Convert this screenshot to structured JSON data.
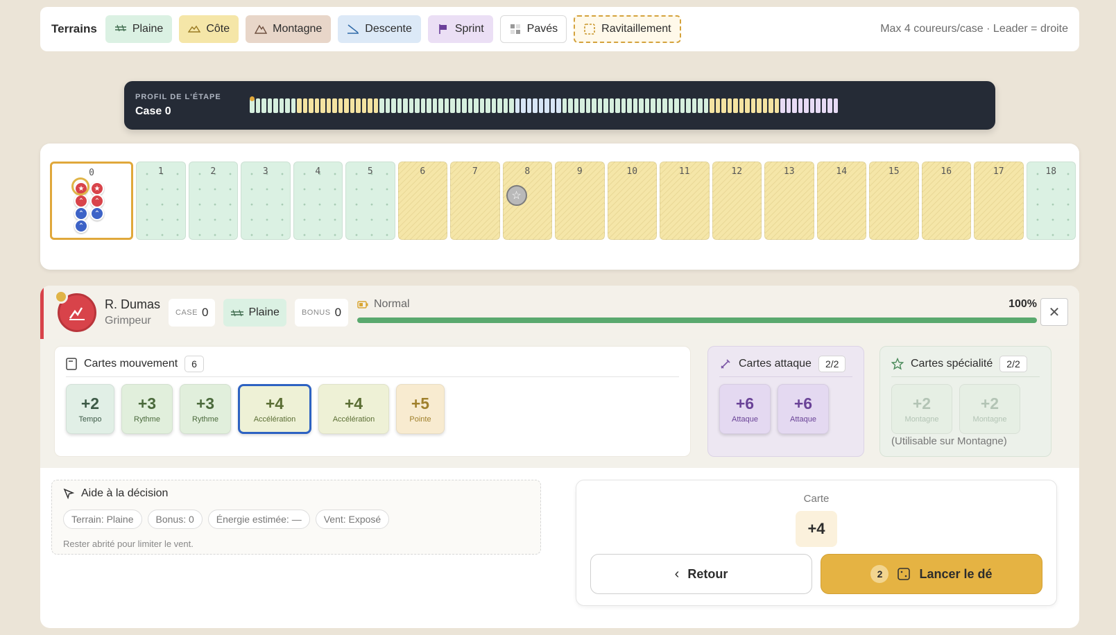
{
  "legend": {
    "title": "Terrains",
    "chips": [
      {
        "label": "Plaine",
        "bg": "#dbf1e3",
        "icon": "plaine-icon"
      },
      {
        "label": "Côte",
        "bg": "#f5e6a8",
        "icon": "cote-icon"
      },
      {
        "label": "Montagne",
        "bg": "#e8d6c9",
        "icon": "montagne-icon"
      },
      {
        "label": "Descente",
        "bg": "#dce9f7",
        "icon": "descente-icon"
      },
      {
        "label": "Sprint",
        "bg": "#ebdff5",
        "icon": "sprint-flag-icon"
      },
      {
        "label": "Pavés",
        "bg": "#ffffff",
        "icon": "paves-icon"
      },
      {
        "label": "Ravitaillement",
        "bg": "#fff9ea",
        "icon": "ravitaillement-icon"
      }
    ],
    "info": "Max 4 coureurs/case · Leader = droite"
  },
  "profile": {
    "label": "PROFIL DE L'ÉTAPE",
    "case": "Case 0",
    "segments": [
      "plaine",
      "plaine",
      "plaine",
      "plaine",
      "plaine",
      "plaine",
      "plaine",
      "plaine",
      "cote",
      "cote",
      "cote",
      "cote",
      "cote",
      "cote",
      "cote",
      "cote",
      "cote",
      "cote",
      "cote",
      "cote",
      "cote",
      "cote",
      "plaine",
      "plaine",
      "plaine",
      "plaine",
      "plaine",
      "plaine",
      "plaine",
      "plaine",
      "plaine",
      "plaine",
      "plaine",
      "plaine",
      "plaine",
      "plaine",
      "plaine",
      "plaine",
      "plaine",
      "plaine",
      "plaine",
      "plaine",
      "plaine",
      "plaine",
      "plaine",
      "descente",
      "descente",
      "descente",
      "descente",
      "descente",
      "descente",
      "descente",
      "descente",
      "plaine",
      "plaine",
      "plaine",
      "plaine",
      "plaine",
      "plaine",
      "plaine",
      "plaine",
      "plaine",
      "plaine",
      "plaine",
      "plaine",
      "plaine",
      "plaine",
      "plaine",
      "plaine",
      "plaine",
      "plaine",
      "plaine",
      "plaine",
      "plaine",
      "plaine",
      "plaine",
      "plaine",
      "plaine",
      "cote",
      "cote",
      "cote",
      "cote",
      "cote",
      "cote",
      "cote",
      "cote",
      "cote",
      "cote",
      "cote",
      "cote",
      "sprint",
      "sprint",
      "sprint",
      "sprint",
      "sprint",
      "sprint",
      "sprint",
      "sprint",
      "sprint",
      "sprint"
    ]
  },
  "track": {
    "cells": [
      {
        "n": "0",
        "t": "active"
      },
      {
        "n": "1",
        "t": "plain"
      },
      {
        "n": "2",
        "t": "plain"
      },
      {
        "n": "3",
        "t": "plain"
      },
      {
        "n": "4",
        "t": "plain"
      },
      {
        "n": "5",
        "t": "plain"
      },
      {
        "n": "6",
        "t": "cote"
      },
      {
        "n": "7",
        "t": "cote"
      },
      {
        "n": "8",
        "t": "cote"
      },
      {
        "n": "9",
        "t": "cote"
      },
      {
        "n": "10",
        "t": "cote"
      },
      {
        "n": "11",
        "t": "cote"
      },
      {
        "n": "12",
        "t": "cote"
      },
      {
        "n": "13",
        "t": "cote"
      },
      {
        "n": "14",
        "t": "cote"
      },
      {
        "n": "15",
        "t": "cote"
      },
      {
        "n": "16",
        "t": "cote"
      },
      {
        "n": "17",
        "t": "cote"
      },
      {
        "n": "18",
        "t": "plain"
      }
    ]
  },
  "rider": {
    "name": "R. Dumas",
    "role": "Grimpeur",
    "case_label": "CASE",
    "case_value": "0",
    "terrain": "Plaine",
    "bonus_label": "BONUS",
    "bonus_value": "0",
    "energy_label": "Normal",
    "energy_pct": "100%",
    "energy_fraction": 1.0,
    "color": "#d8434a"
  },
  "movement": {
    "title": "Cartes mouvement",
    "count": "6",
    "cards": [
      {
        "v": "+2",
        "l": "Tempo",
        "bg": "#e1efe6",
        "fg": "#3d5a47",
        "w": 70
      },
      {
        "v": "+3",
        "l": "Rythme",
        "bg": "#e1efdc",
        "fg": "#4b6a3c",
        "w": 74
      },
      {
        "v": "+3",
        "l": "Rythme",
        "bg": "#e1efdc",
        "fg": "#4b6a3c",
        "w": 74
      },
      {
        "v": "+4",
        "l": "Accélération",
        "bg": "#eef1d6",
        "fg": "#5b6e34",
        "w": 106,
        "selected": true
      },
      {
        "v": "+4",
        "l": "Accélération",
        "bg": "#eef1d6",
        "fg": "#5b6e34",
        "w": 102
      },
      {
        "v": "+5",
        "l": "Pointe",
        "bg": "#f8ebd0",
        "fg": "#a0802c",
        "w": 70
      }
    ]
  },
  "attack": {
    "title": "Cartes attaque",
    "count": "2/2",
    "cards": [
      {
        "v": "+6",
        "l": "Attaque"
      },
      {
        "v": "+6",
        "l": "Attaque"
      }
    ]
  },
  "special": {
    "title": "Cartes spécialité",
    "count": "2/2",
    "cards": [
      {
        "v": "+2",
        "l": "Montagne"
      },
      {
        "v": "+2",
        "l": "Montagne"
      }
    ],
    "note": "(Utilisable sur Montagne)"
  },
  "help": {
    "title": "Aide à la décision",
    "pills": [
      "Terrain: Plaine",
      "Bonus: 0",
      "Énergie estimée: —",
      "Vent: Exposé"
    ],
    "note": "Rester abrité pour limiter le vent."
  },
  "action": {
    "label": "Carte",
    "card": "+4",
    "back": "Retour",
    "roll": "Lancer le dé",
    "roll_badge": "2"
  }
}
